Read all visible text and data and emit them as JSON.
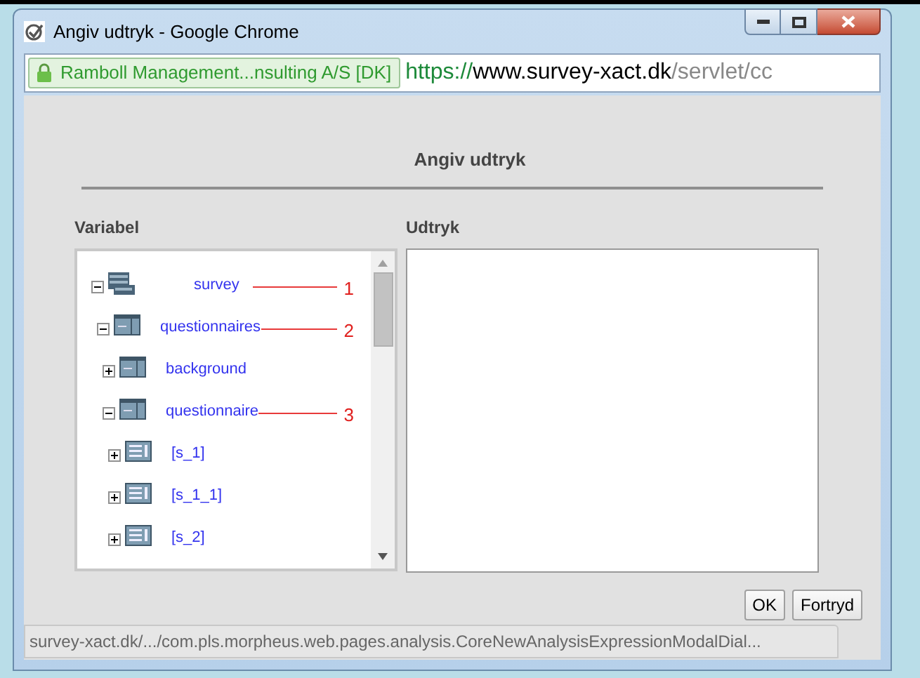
{
  "window": {
    "title": "Angiv udtryk - Google Chrome"
  },
  "address_bar": {
    "site_identity": "Ramboll Management...nsulting A/S [DK]",
    "url_scheme": "https://",
    "url_host": "www.survey-xact.dk",
    "url_path": "/servlet/cc"
  },
  "dialog": {
    "heading": "Angiv udtryk",
    "variable_label": "Variabel",
    "expression_label": "Udtryk",
    "tree": [
      {
        "label": "survey",
        "kind": "survey",
        "expanded": true,
        "annotation": "1",
        "children": [
          {
            "label": "questionnaires",
            "kind": "questionnaire",
            "expanded": true,
            "annotation": "2",
            "children": [
              {
                "label": "background",
                "kind": "questionnaire",
                "expanded": false
              },
              {
                "label": "questionnaire",
                "kind": "questionnaire",
                "expanded": true,
                "annotation": "3",
                "children": [
                  {
                    "label": "[s_1]",
                    "kind": "section",
                    "expanded": false
                  },
                  {
                    "label": "[s_1_1]",
                    "kind": "section",
                    "expanded": false
                  },
                  {
                    "label": "[s_2]",
                    "kind": "section",
                    "expanded": false
                  }
                ]
              }
            ]
          }
        ]
      }
    ],
    "buttons": [
      "OK",
      "Fortryd"
    ]
  },
  "status_bar": "survey-xact.dk/.../com.pls.morpheus.web.pages.analysis.CoreNewAnalysisExpressionModalDial..."
}
